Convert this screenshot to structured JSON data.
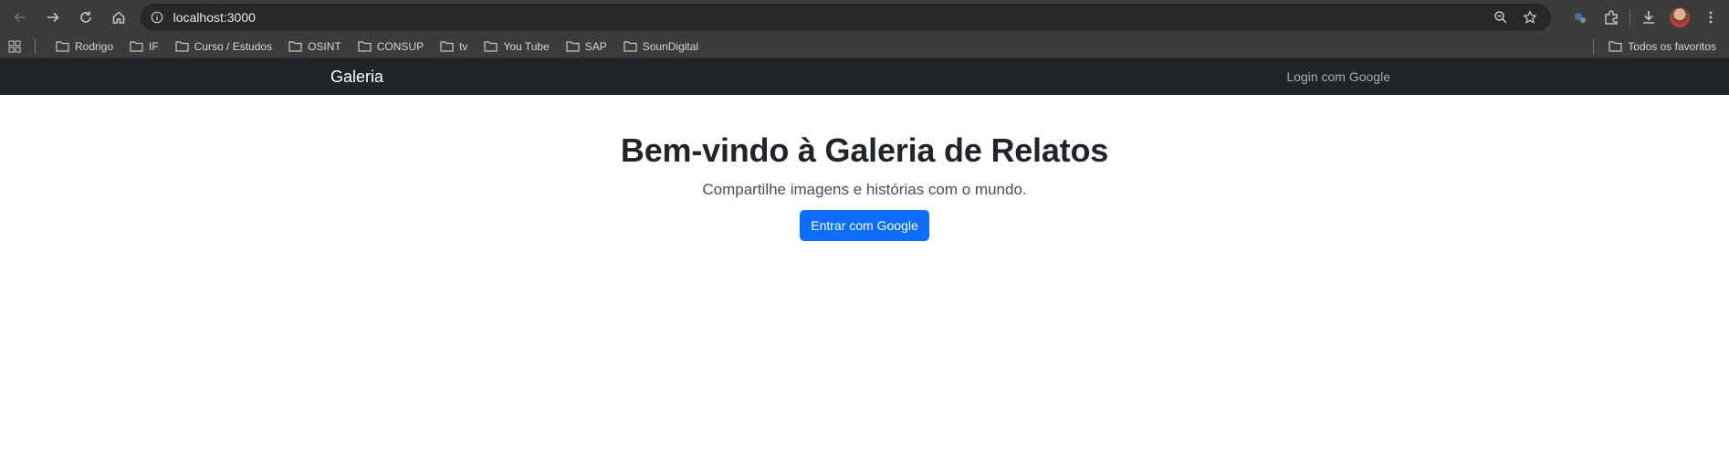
{
  "browser": {
    "url": "localhost:3000",
    "bookmarks": [
      {
        "label": "Rodrigo"
      },
      {
        "label": "IF"
      },
      {
        "label": "Curso / Estudos"
      },
      {
        "label": "OSINT"
      },
      {
        "label": "CONSUP"
      },
      {
        "label": "tv"
      },
      {
        "label": "You Tube"
      },
      {
        "label": "SAP"
      },
      {
        "label": "SounDigital"
      }
    ],
    "all_bookmarks_label": "Todos os favoritos"
  },
  "navbar": {
    "brand": "Galeria",
    "login_link": "Login com Google"
  },
  "hero": {
    "title": "Bem-vindo à Galeria de Relatos",
    "subtitle": "Compartilhe imagens e histórias com o mundo.",
    "button_label": "Entrar com Google"
  },
  "colors": {
    "navbar_bg": "#212529",
    "primary_button": "#0d6efd",
    "browser_chrome": "#3c3c3c"
  }
}
